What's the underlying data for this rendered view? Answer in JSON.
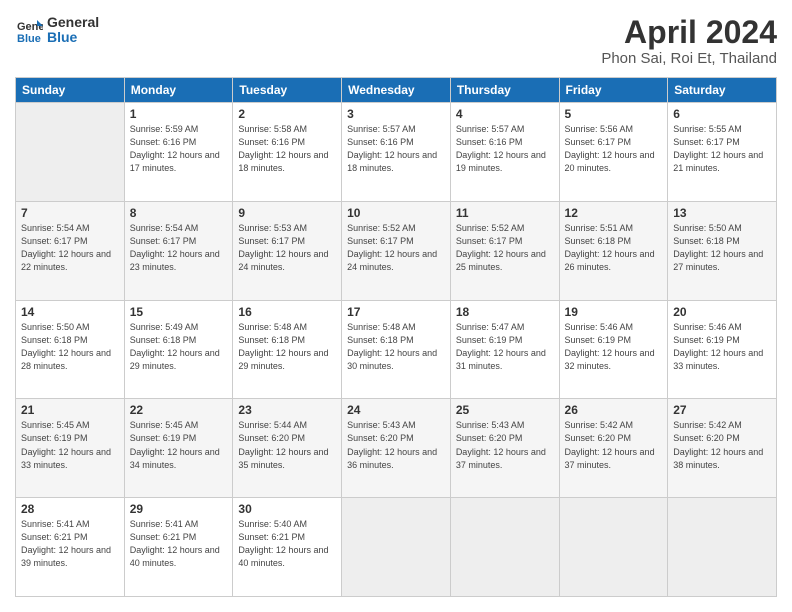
{
  "header": {
    "logo_line1": "General",
    "logo_line2": "Blue",
    "title": "April 2024",
    "subtitle": "Phon Sai, Roi Et, Thailand"
  },
  "days_of_week": [
    "Sunday",
    "Monday",
    "Tuesday",
    "Wednesday",
    "Thursday",
    "Friday",
    "Saturday"
  ],
  "weeks": [
    [
      null,
      {
        "day": 1,
        "rise": "5:59 AM",
        "set": "6:16 PM",
        "hours": "12 hours and 17 minutes."
      },
      {
        "day": 2,
        "rise": "5:58 AM",
        "set": "6:16 PM",
        "hours": "12 hours and 18 minutes."
      },
      {
        "day": 3,
        "rise": "5:57 AM",
        "set": "6:16 PM",
        "hours": "12 hours and 18 minutes."
      },
      {
        "day": 4,
        "rise": "5:57 AM",
        "set": "6:16 PM",
        "hours": "12 hours and 19 minutes."
      },
      {
        "day": 5,
        "rise": "5:56 AM",
        "set": "6:17 PM",
        "hours": "12 hours and 20 minutes."
      },
      {
        "day": 6,
        "rise": "5:55 AM",
        "set": "6:17 PM",
        "hours": "12 hours and 21 minutes."
      }
    ],
    [
      {
        "day": 7,
        "rise": "5:54 AM",
        "set": "6:17 PM",
        "hours": "12 hours and 22 minutes."
      },
      {
        "day": 8,
        "rise": "5:54 AM",
        "set": "6:17 PM",
        "hours": "12 hours and 23 minutes."
      },
      {
        "day": 9,
        "rise": "5:53 AM",
        "set": "6:17 PM",
        "hours": "12 hours and 24 minutes."
      },
      {
        "day": 10,
        "rise": "5:52 AM",
        "set": "6:17 PM",
        "hours": "12 hours and 24 minutes."
      },
      {
        "day": 11,
        "rise": "5:52 AM",
        "set": "6:17 PM",
        "hours": "12 hours and 25 minutes."
      },
      {
        "day": 12,
        "rise": "5:51 AM",
        "set": "6:18 PM",
        "hours": "12 hours and 26 minutes."
      },
      {
        "day": 13,
        "rise": "5:50 AM",
        "set": "6:18 PM",
        "hours": "12 hours and 27 minutes."
      }
    ],
    [
      {
        "day": 14,
        "rise": "5:50 AM",
        "set": "6:18 PM",
        "hours": "12 hours and 28 minutes."
      },
      {
        "day": 15,
        "rise": "5:49 AM",
        "set": "6:18 PM",
        "hours": "12 hours and 29 minutes."
      },
      {
        "day": 16,
        "rise": "5:48 AM",
        "set": "6:18 PM",
        "hours": "12 hours and 29 minutes."
      },
      {
        "day": 17,
        "rise": "5:48 AM",
        "set": "6:18 PM",
        "hours": "12 hours and 30 minutes."
      },
      {
        "day": 18,
        "rise": "5:47 AM",
        "set": "6:19 PM",
        "hours": "12 hours and 31 minutes."
      },
      {
        "day": 19,
        "rise": "5:46 AM",
        "set": "6:19 PM",
        "hours": "12 hours and 32 minutes."
      },
      {
        "day": 20,
        "rise": "5:46 AM",
        "set": "6:19 PM",
        "hours": "12 hours and 33 minutes."
      }
    ],
    [
      {
        "day": 21,
        "rise": "5:45 AM",
        "set": "6:19 PM",
        "hours": "12 hours and 33 minutes."
      },
      {
        "day": 22,
        "rise": "5:45 AM",
        "set": "6:19 PM",
        "hours": "12 hours and 34 minutes."
      },
      {
        "day": 23,
        "rise": "5:44 AM",
        "set": "6:20 PM",
        "hours": "12 hours and 35 minutes."
      },
      {
        "day": 24,
        "rise": "5:43 AM",
        "set": "6:20 PM",
        "hours": "12 hours and 36 minutes."
      },
      {
        "day": 25,
        "rise": "5:43 AM",
        "set": "6:20 PM",
        "hours": "12 hours and 37 minutes."
      },
      {
        "day": 26,
        "rise": "5:42 AM",
        "set": "6:20 PM",
        "hours": "12 hours and 37 minutes."
      },
      {
        "day": 27,
        "rise": "5:42 AM",
        "set": "6:20 PM",
        "hours": "12 hours and 38 minutes."
      }
    ],
    [
      {
        "day": 28,
        "rise": "5:41 AM",
        "set": "6:21 PM",
        "hours": "12 hours and 39 minutes."
      },
      {
        "day": 29,
        "rise": "5:41 AM",
        "set": "6:21 PM",
        "hours": "12 hours and 40 minutes."
      },
      {
        "day": 30,
        "rise": "5:40 AM",
        "set": "6:21 PM",
        "hours": "12 hours and 40 minutes."
      },
      null,
      null,
      null,
      null
    ]
  ]
}
